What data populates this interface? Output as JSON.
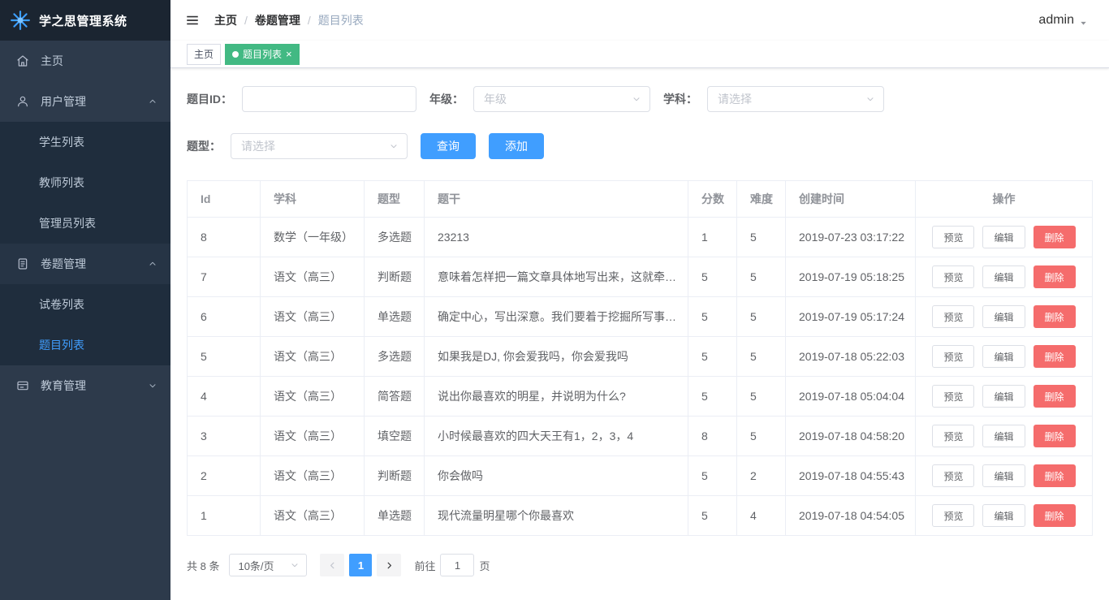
{
  "colors": {
    "primary": "#409EFF",
    "danger": "#F56C6C",
    "tab_active_green": "#42b983",
    "sidebar_bg": "#2d3a4b",
    "sidebar_submenu_bg": "#1f2d3d"
  },
  "app": {
    "title": "学之思管理系统",
    "user_name": "admin"
  },
  "breadcrumb": {
    "items": [
      "主页",
      "卷题管理",
      "题目列表"
    ],
    "separator": "/"
  },
  "tabs": {
    "items": [
      {
        "label": "主页",
        "active": false,
        "closable": false
      },
      {
        "label": "题目列表",
        "active": true,
        "closable": true
      }
    ]
  },
  "sidebar": {
    "items": [
      {
        "label": "主页",
        "icon": "home-icon"
      },
      {
        "label": "用户管理",
        "icon": "user-icon",
        "expanded": true,
        "children": [
          {
            "label": "学生列表"
          },
          {
            "label": "教师列表"
          },
          {
            "label": "管理员列表"
          }
        ]
      },
      {
        "label": "卷题管理",
        "icon": "document-icon",
        "expanded": true,
        "children": [
          {
            "label": "试卷列表"
          },
          {
            "label": "题目列表",
            "active": true
          }
        ]
      },
      {
        "label": "教育管理",
        "icon": "education-icon",
        "expanded": false,
        "children": []
      }
    ]
  },
  "filters": {
    "question_id": {
      "label": "题目ID：",
      "value": ""
    },
    "grade": {
      "label": "年级：",
      "placeholder": "年级"
    },
    "subject": {
      "label": "学科：",
      "placeholder": "请选择"
    },
    "question_type": {
      "label": "题型：",
      "placeholder": "请选择"
    },
    "search_button": "查询",
    "add_button": "添加"
  },
  "table": {
    "headers": [
      "Id",
      "学科",
      "题型",
      "题干",
      "分数",
      "难度",
      "创建时间",
      "操作"
    ],
    "actions": [
      {
        "label": "预览",
        "kind": "plain",
        "name": "preview-button"
      },
      {
        "label": "编辑",
        "kind": "plain",
        "name": "edit-button"
      },
      {
        "label": "删除",
        "kind": "danger",
        "name": "delete-button"
      }
    ],
    "rows": [
      {
        "id": "8",
        "subject": "数学（一年级）",
        "qtype": "多选题",
        "stem": "23213",
        "score": "1",
        "difficulty": "5",
        "created_at": "2019-07-23 03:17:22"
      },
      {
        "id": "7",
        "subject": "语文（高三）",
        "qtype": "判断题",
        "stem": "意味着怎样把一篇文章具体地写出来，这就牵涉…",
        "score": "5",
        "difficulty": "5",
        "created_at": "2019-07-19 05:18:25"
      },
      {
        "id": "6",
        "subject": "语文（高三）",
        "qtype": "单选题",
        "stem": "确定中心，写出深意。我们要着于挖掘所写事件…",
        "score": "5",
        "difficulty": "5",
        "created_at": "2019-07-19 05:17:24"
      },
      {
        "id": "5",
        "subject": "语文（高三）",
        "qtype": "多选题",
        "stem": "如果我是DJ, 你会爱我吗，你会爱我吗",
        "score": "5",
        "difficulty": "5",
        "created_at": "2019-07-18 05:22:03"
      },
      {
        "id": "4",
        "subject": "语文（高三）",
        "qtype": "简答题",
        "stem": "说出你最喜欢的明星，并说明为什么?",
        "score": "5",
        "difficulty": "5",
        "created_at": "2019-07-18 05:04:04"
      },
      {
        "id": "3",
        "subject": "语文（高三）",
        "qtype": "填空题",
        "stem": "小时候最喜欢的四大天王有1，2，3，4",
        "score": "8",
        "difficulty": "5",
        "created_at": "2019-07-18 04:58:20"
      },
      {
        "id": "2",
        "subject": "语文（高三）",
        "qtype": "判断题",
        "stem": "你会做吗",
        "score": "5",
        "difficulty": "2",
        "created_at": "2019-07-18 04:55:43"
      },
      {
        "id": "1",
        "subject": "语文（高三）",
        "qtype": "单选题",
        "stem": "现代流量明星哪个你最喜欢",
        "score": "5",
        "difficulty": "4",
        "created_at": "2019-07-18 04:54:05"
      }
    ]
  },
  "pagination": {
    "total_text": "共 8 条",
    "page_size": "10条/页",
    "current_page": "1",
    "goto_label": "前往",
    "goto_value": "1",
    "page_unit": "页"
  }
}
